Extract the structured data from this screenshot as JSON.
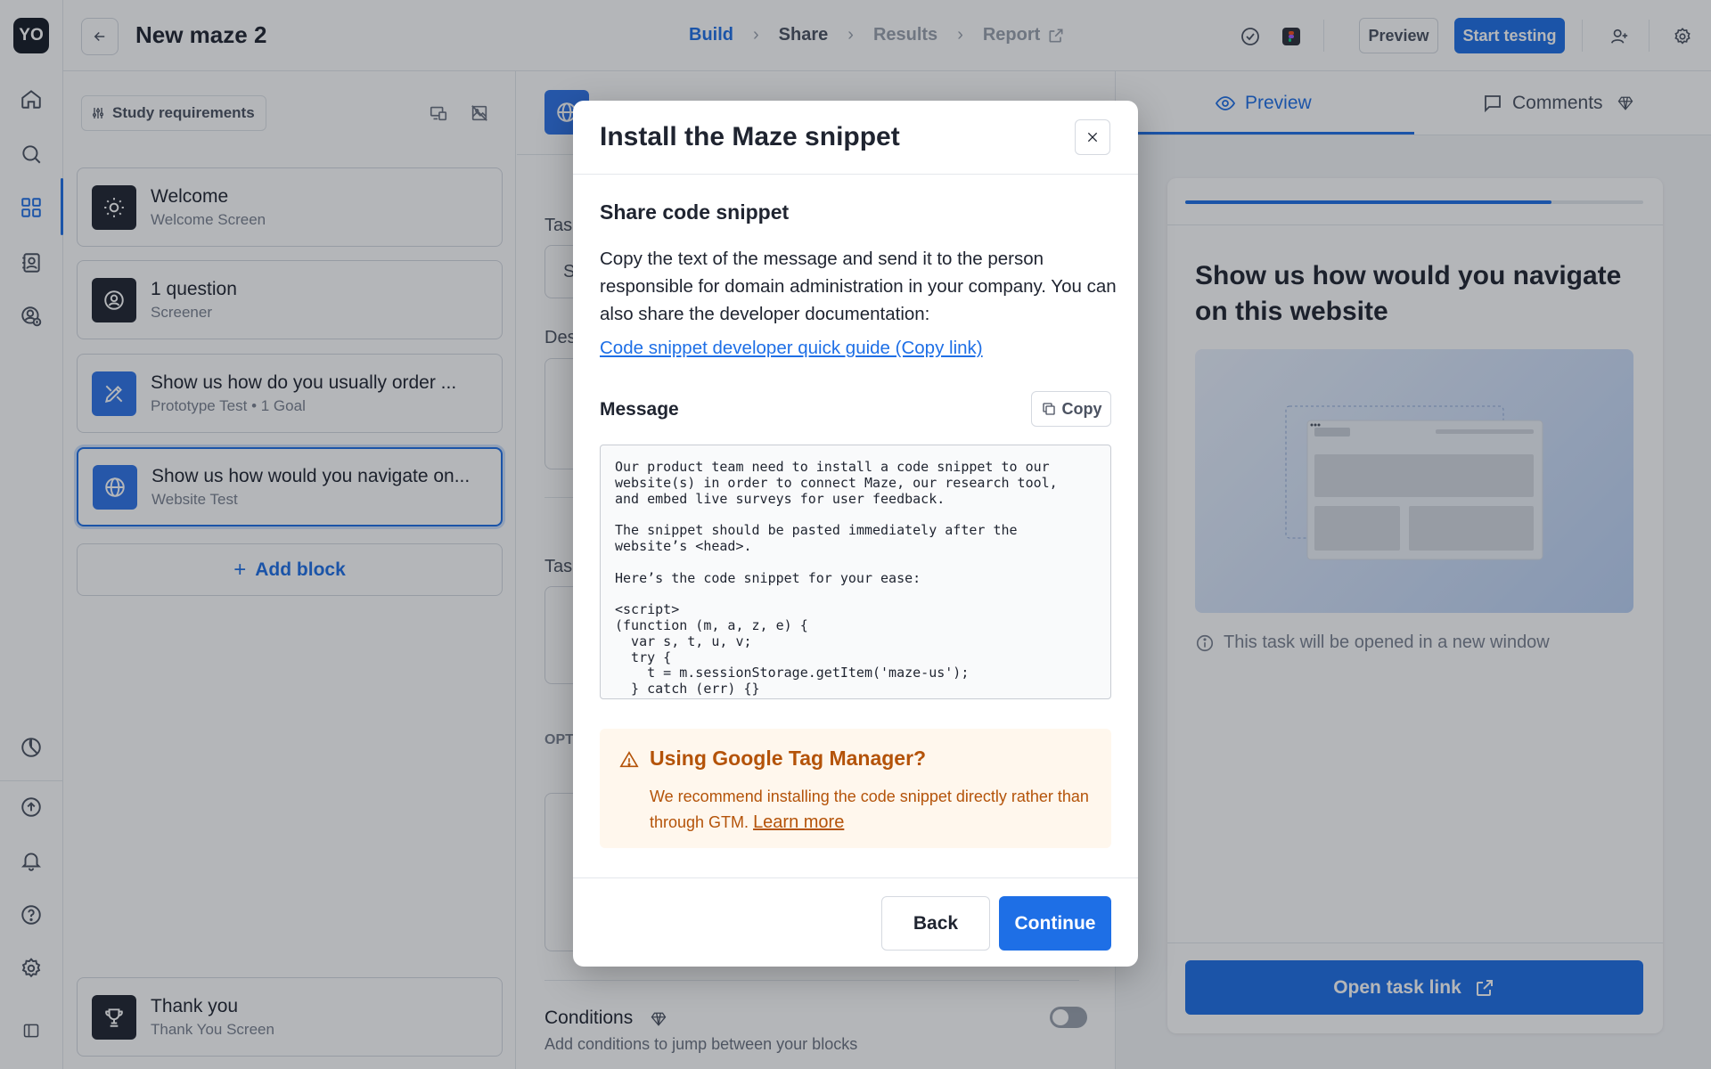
{
  "header": {
    "avatar": "YO",
    "title": "New maze 2",
    "steps": [
      "Build",
      "Share",
      "Results",
      "Report"
    ],
    "preview_label": "Preview",
    "start_label": "Start testing"
  },
  "left": {
    "requirements_label": "Study requirements",
    "blocks": [
      {
        "title": "Welcome",
        "subtitle": "Welcome Screen",
        "icon": "sun-icon"
      },
      {
        "title": "1 question",
        "subtitle": "Screener",
        "icon": "screener-icon"
      },
      {
        "title": "Show us how do you usually order ...",
        "subtitle": "Prototype Test • 1 Goal",
        "icon": "prototype-icon"
      },
      {
        "title": "Show us how would you navigate on...",
        "subtitle": "Website Test",
        "icon": "globe-icon"
      }
    ],
    "add_block_label": "Add block",
    "thank_you": {
      "title": "Thank you",
      "subtitle": "Thank You Screen",
      "icon": "trophy-icon"
    }
  },
  "middle": {
    "frag1": "Tas",
    "frag2": "S",
    "frag3": "Des",
    "frag4": "Tas",
    "frag5": "OPT",
    "conditions_label": "Conditions",
    "conditions_sub": "Add conditions to jump between your blocks"
  },
  "right": {
    "tab_preview": "Preview",
    "tab_comments": "Comments",
    "progress": 0.8,
    "heading": "Show us how would you navigate on this website",
    "note": "This task will be opened in a new window",
    "open_label": "Open task link"
  },
  "modal": {
    "title": "Install the Maze snippet",
    "subtitle": "Share code snippet",
    "paragraph": "Copy the text of the message and send it to the person responsible for domain administration in your company. You can also share the developer documentation:",
    "link": "Code snippet developer quick guide (Copy link)",
    "message_label": "Message",
    "copy_label": "Copy",
    "code": "Our product team need to install a code snippet to our\nwebsite(s) in order to connect Maze, our research tool,\nand embed live surveys for user feedback.\n\nThe snippet should be pasted immediately after the\nwebsite’s <head>.\n\nHere’s the code snippet for your ease:\n\n<script>\n(function (m, a, z, e) {\n  var s, t, u, v;\n  try {\n    t = m.sessionStorage.getItem('maze-us');\n  } catch (err) {}",
    "warning_title": "Using Google Tag Manager?",
    "warning_body": "We recommend installing the code snippet directly rather than through GTM.",
    "warning_link": "Learn more",
    "back_label": "Back",
    "continue_label": "Continue"
  }
}
